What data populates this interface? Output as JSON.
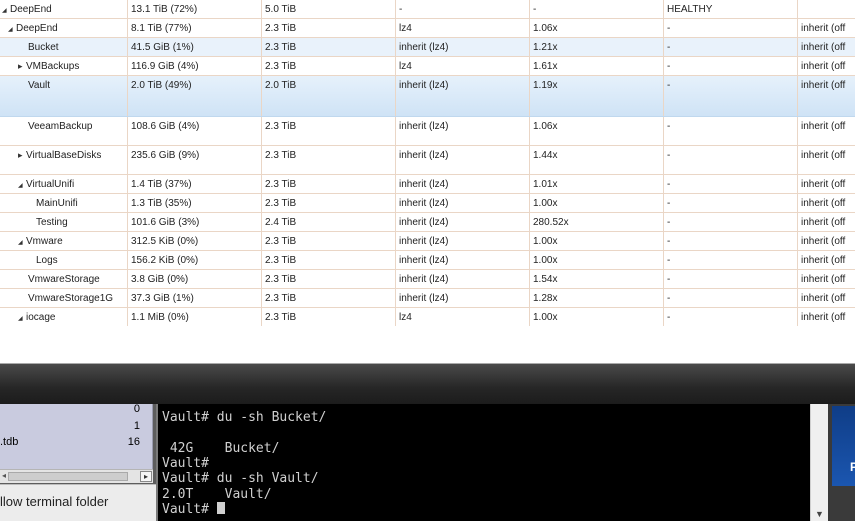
{
  "table": {
    "rows": [
      {
        "name": "DeepEnd",
        "expander": "collapsed-down",
        "used": "13.1 TiB (72%)",
        "available": "5.0 TiB",
        "compression": "-",
        "ratio": "-",
        "status": "HEALTHY",
        "readonly": ""
      },
      {
        "name": "DeepEnd",
        "expander": "expanded",
        "used": "8.1 TiB (77%)",
        "available": "2.3 TiB",
        "compression": "lz4",
        "ratio": "1.06x",
        "status": "-",
        "readonly": "inherit (off"
      },
      {
        "name": "Bucket",
        "expander": "",
        "used": "41.5 GiB (1%)",
        "available": "2.3 TiB",
        "compression": "inherit (lz4)",
        "ratio": "1.21x",
        "status": "-",
        "readonly": "inherit (off"
      },
      {
        "name": "VMBackups",
        "expander": "collapsed",
        "used": "116.9 GiB (4%)",
        "available": "2.3 TiB",
        "compression": "lz4",
        "ratio": "1.61x",
        "status": "-",
        "readonly": "inherit (off"
      },
      {
        "name": "Vault",
        "expander": "",
        "used": "2.0 TiB (49%)",
        "available": "2.0 TiB",
        "compression": "inherit (lz4)",
        "ratio": "1.19x",
        "status": "-",
        "readonly": "inherit (off"
      },
      {
        "name": "VeeamBackup",
        "expander": "",
        "used": "108.6 GiB (4%)",
        "available": "2.3 TiB",
        "compression": "inherit (lz4)",
        "ratio": "1.06x",
        "status": "-",
        "readonly": "inherit (off"
      },
      {
        "name": "VirtualBaseDisks",
        "expander": "collapsed",
        "used": "235.6 GiB (9%)",
        "available": "2.3 TiB",
        "compression": "inherit (lz4)",
        "ratio": "1.44x",
        "status": "-",
        "readonly": "inherit (off"
      },
      {
        "name": "VirtualUnifi",
        "expander": "expanded",
        "used": "1.4 TiB (37%)",
        "available": "2.3 TiB",
        "compression": "inherit (lz4)",
        "ratio": "1.01x",
        "status": "-",
        "readonly": "inherit (off"
      },
      {
        "name": "MainUnifi",
        "expander": "",
        "used": "1.3 TiB (35%)",
        "available": "2.3 TiB",
        "compression": "inherit (lz4)",
        "ratio": "1.00x",
        "status": "-",
        "readonly": "inherit (off"
      },
      {
        "name": "Testing",
        "expander": "",
        "used": "101.6 GiB (3%)",
        "available": "2.4 TiB",
        "compression": "inherit (lz4)",
        "ratio": "280.52x",
        "status": "-",
        "readonly": "inherit (off"
      },
      {
        "name": "Vmware",
        "expander": "expanded",
        "used": "312.5 KiB (0%)",
        "available": "2.3 TiB",
        "compression": "inherit (lz4)",
        "ratio": "1.00x",
        "status": "-",
        "readonly": "inherit (off"
      },
      {
        "name": "Logs",
        "expander": "",
        "used": "156.2 KiB (0%)",
        "available": "2.3 TiB",
        "compression": "inherit (lz4)",
        "ratio": "1.00x",
        "status": "-",
        "readonly": "inherit (off"
      },
      {
        "name": "VmwareStorage",
        "expander": "",
        "used": "3.8 GiB (0%)",
        "available": "2.3 TiB",
        "compression": "inherit (lz4)",
        "ratio": "1.54x",
        "status": "-",
        "readonly": "inherit (off"
      },
      {
        "name": "VmwareStorage1G",
        "expander": "",
        "used": "37.3 GiB (1%)",
        "available": "2.3 TiB",
        "compression": "inherit (lz4)",
        "ratio": "1.28x",
        "status": "-",
        "readonly": "inherit (off"
      },
      {
        "name": "iocage",
        "expander": "expanded",
        "used": "1.1 MiB (0%)",
        "available": "2.3 TiB",
        "compression": "lz4",
        "ratio": "1.00x",
        "status": "-",
        "readonly": "inherit (off"
      }
    ],
    "selected_row": "Vault",
    "colors": {
      "selected": "#cfe3f6",
      "row_border": "#ead6c6"
    }
  },
  "file_panel": {
    "rows": [
      {
        "name": "",
        "value": "0"
      },
      {
        "name": "",
        "value": "1"
      },
      {
        "name": ".tdb",
        "value": "16"
      }
    ],
    "follow_label": "llow terminal folder"
  },
  "terminal": {
    "lines": [
      "Vault# du -sh Bucket/",
      "",
      " 42G    Bucket/",
      "Vault#",
      "Vault# du -sh Vault/",
      "2.0T    Vault/",
      "Vault# "
    ],
    "colors": {
      "background": "#000000",
      "foreground": "#d0d0d0"
    }
  },
  "right_panel": {
    "text": "PS"
  }
}
